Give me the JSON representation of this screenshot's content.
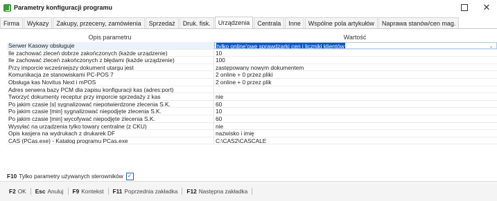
{
  "window": {
    "title": "Parametry konfiguracji programu",
    "maximize_glyph": "☐",
    "close_glyph": "✕"
  },
  "tabs": [
    {
      "label": "Firma"
    },
    {
      "label": "Wykazy"
    },
    {
      "label": "Zakupy, przeceny, zamówienia"
    },
    {
      "label": "Sprzedaż"
    },
    {
      "label": "Druk. fisk."
    },
    {
      "label": "Urządzenia"
    },
    {
      "label": "Centrala"
    },
    {
      "label": "Inne"
    },
    {
      "label": "Wspólne pola artykułów"
    },
    {
      "label": "Naprawa stanów/cen mag."
    }
  ],
  "grid": {
    "col_label": "Opis parametru",
    "col_value": "Wartość",
    "rows": [
      {
        "label": "Serwer Kasowy obsługuje",
        "value": "tylko online'owe sprawdzarki cen i liczniki klientów"
      },
      {
        "label": "Ile zachować zleceń dobrze zakończonych (każde urządzenie)",
        "value": "10"
      },
      {
        "label": "Ile zachować zleceń zakończonych z błędami (każde urządzenie)",
        "value": "100"
      },
      {
        "label": "Przy imporcie wcześniejszy dokument utargu jest",
        "value": "zastępowany nowym dokumentem"
      },
      {
        "label": "Komunikacja ze stanowiskami PC-POS 7",
        "value": "2 online + 0 przez pliki"
      },
      {
        "label": "Obsługa kas Novitus Next i mPOS",
        "value": "2 online + 0 przez plik"
      },
      {
        "label": "Adres serwera bazy PCM dla zapisu konfiguracji kas (adres:port)",
        "value": ""
      },
      {
        "label": "Tworzyć dokumenty receptur przy imporcie sprzedaży z kas",
        "value": "nie"
      },
      {
        "label": "Po jakim czasie [s] sygnalizować niepotwierdzone zlecenia S.K.",
        "value": "60"
      },
      {
        "label": "Po jakim czasie [min] sygnalizować niepodjęte zlecenia S.K.",
        "value": "10"
      },
      {
        "label": "Po jakim czasie [min] wycofywać niepodjęte zlecenia S.K.",
        "value": "60"
      },
      {
        "label": "Wysyłać na urządzenia tylko towary centralne (z CKU)",
        "value": "nie"
      },
      {
        "label": "Opis kasjera na wydrukach z drukarek DF",
        "value": "nazwisko i imię"
      },
      {
        "label": "CAS (PCas.exe) - Katalog programu PCas.exe",
        "value": "C:\\CAS2\\CASCALE"
      }
    ]
  },
  "filter": {
    "key": "F10",
    "label": "Tylko parametry używanych sterowników",
    "checked": true,
    "check_glyph": "✓"
  },
  "footer": [
    {
      "key": "F2",
      "label": "OK"
    },
    {
      "key": "Esc",
      "label": "Anuluj"
    },
    {
      "key": "F9",
      "label": "Kontekst"
    },
    {
      "key": "F11",
      "label": "Poprzednia zakładka"
    },
    {
      "key": "F12",
      "label": "Następna zakładka"
    }
  ],
  "colors": {
    "selection": "#0a56c8",
    "app_icon": "#3c9a3a",
    "checkbox": "#2a62b8"
  }
}
